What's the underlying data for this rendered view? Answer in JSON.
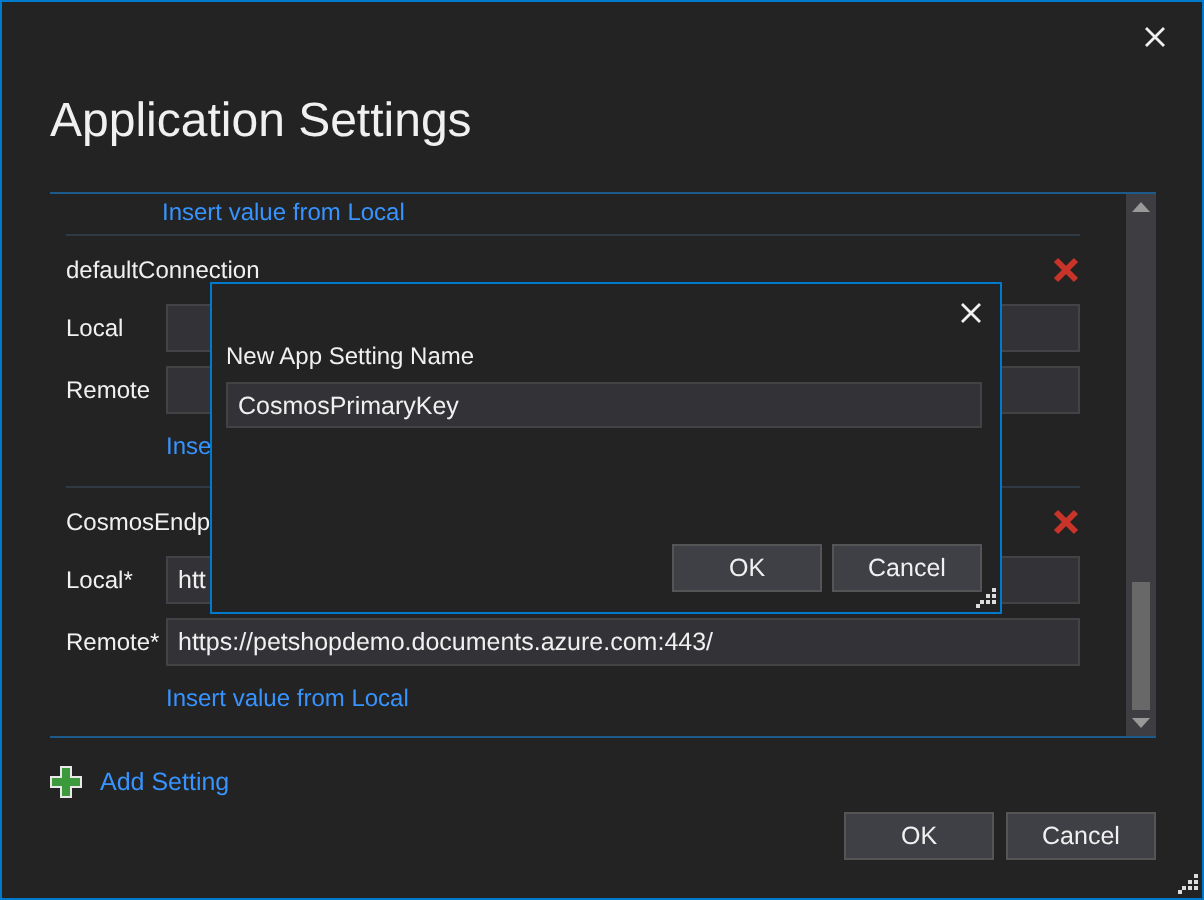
{
  "window": {
    "title": "Application Settings"
  },
  "top_link": "Insert value from Local",
  "settings": [
    {
      "name": "defaultConnection",
      "fields": [
        {
          "label": "Local"
        },
        {
          "label": "Remote"
        }
      ],
      "link": "Inse"
    },
    {
      "name": "CosmosEndp",
      "fields": [
        {
          "label": "Local*",
          "value": "htt"
        },
        {
          "label": "Remote*",
          "value": "https://petshopdemo.documents.azure.com:443/"
        }
      ],
      "link": "Insert value from Local"
    }
  ],
  "add_setting": "Add Setting",
  "buttons": [
    "OK",
    "Cancel"
  ],
  "popup": {
    "label": "New App Setting Name",
    "value": "CosmosPrimaryKey",
    "buttons": [
      "OK",
      "Cancel"
    ]
  }
}
